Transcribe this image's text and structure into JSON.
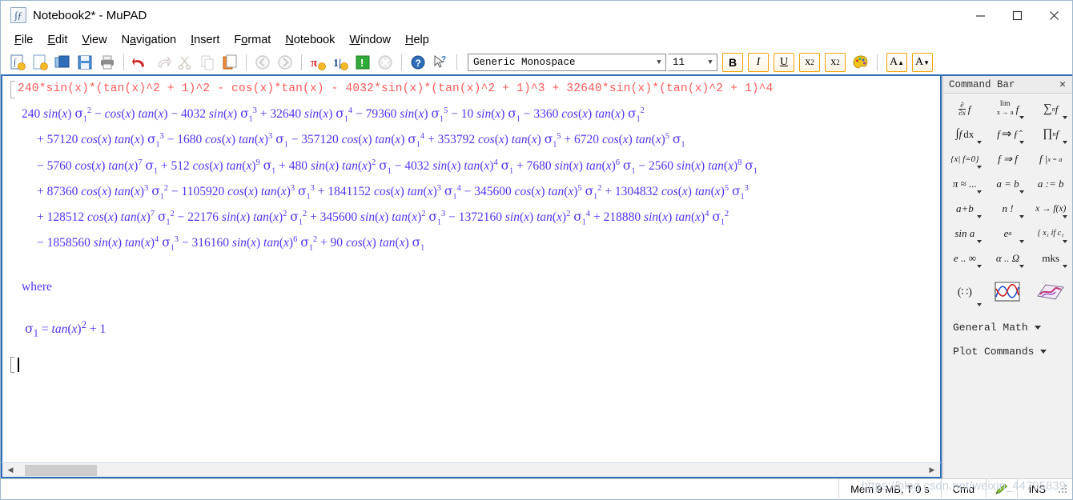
{
  "window": {
    "title": "Notebook2* - MuPAD",
    "app_icon": "mupad-document-icon",
    "minimize": "—",
    "maximize": "☐",
    "close": "✕"
  },
  "menubar": {
    "items": [
      {
        "name": "file",
        "label": "File",
        "accel": "F"
      },
      {
        "name": "edit",
        "label": "Edit",
        "accel": "E"
      },
      {
        "name": "view",
        "label": "View",
        "accel": "V"
      },
      {
        "name": "navigation",
        "label": "Navigation",
        "accel": "a"
      },
      {
        "name": "insert",
        "label": "Insert",
        "accel": "I"
      },
      {
        "name": "format",
        "label": "Format",
        "accel": "o"
      },
      {
        "name": "notebook",
        "label": "Notebook",
        "accel": "N"
      },
      {
        "name": "window",
        "label": "Window",
        "accel": "W"
      },
      {
        "name": "help",
        "label": "Help",
        "accel": "H"
      }
    ]
  },
  "toolbar": {
    "buttons": [
      {
        "name": "new-notebook-icon",
        "tip": "New"
      },
      {
        "name": "new-document-icon",
        "tip": "New Document"
      },
      {
        "name": "open-folder-icon",
        "tip": "Open"
      },
      {
        "name": "save-icon",
        "tip": "Save"
      },
      {
        "name": "print-icon",
        "tip": "Print"
      },
      {
        "name": "undo-icon",
        "tip": "Undo"
      },
      {
        "name": "redo-icon",
        "tip": "Redo"
      },
      {
        "name": "cut-scissors-icon",
        "tip": "Cut"
      },
      {
        "name": "copy-icon",
        "tip": "Copy"
      },
      {
        "name": "paste-icon",
        "tip": "Paste"
      },
      {
        "name": "back-arrow-icon",
        "tip": "Back"
      },
      {
        "name": "forward-arrow-icon",
        "tip": "Forward"
      },
      {
        "name": "pi-evaluate-icon",
        "tip": "Evaluate"
      },
      {
        "name": "evaluate-all-icon",
        "tip": "Evaluate All"
      },
      {
        "name": "exclamation-run-icon",
        "tip": "Run"
      },
      {
        "name": "stop-icon",
        "tip": "Stop"
      },
      {
        "name": "help-question-icon",
        "tip": "Help"
      },
      {
        "name": "help-pointer-icon",
        "tip": "Context Help"
      }
    ],
    "font_family": "Generic Monospace",
    "font_size": "11",
    "bold_label": "B",
    "italic_label": "I",
    "underline_label": "U",
    "subscript_label": "x",
    "subscript_index": "2",
    "superscript_label": "x",
    "superscript_index": "2",
    "color_palette": "color-palette-icon",
    "increase_font_label": "A",
    "decrease_font_label": "A"
  },
  "notebook": {
    "input": "240*sin(x)*(tan(x)^2 + 1)^2 - cos(x)*tan(x) - 4032*sin(x)*(tan(x)^2 + 1)^3 + 32640*sin(x)*(tan(x)^2 + 1)^4",
    "output_lines": [
      "240 sin(x) σ₁² − cos(x) tan(x) − 4032 sin(x) σ₁³ + 32640 sin(x) σ₁⁴ − 79360 sin(x) σ₁⁵ − 10 sin(x) σ₁ − 3360 cos(x) tan(x) σ₁²",
      "+ 57120 cos(x) tan(x) σ₁³ − 1680 cos(x) tan(x)³ σ₁ − 357120 cos(x) tan(x) σ₁⁴ + 353792 cos(x) tan(x) σ₁⁵ + 6720 cos(x) tan(x)⁵ σ₁",
      "− 5760 cos(x) tan(x)⁷ σ₁ + 512 cos(x) tan(x)⁹ σ₁ + 480 sin(x) tan(x)² σ₁ − 4032 sin(x) tan(x)⁴ σ₁ + 7680 sin(x) tan(x)⁶ σ₁ − 2560 sin(x) tan(x)⁸ σ₁",
      "+ 87360 cos(x) tan(x)³ σ₁² − 1105920 cos(x) tan(x)³ σ₁³ + 1841152 cos(x) tan(x)³ σ₁⁴ − 345600 cos(x) tan(x)⁵ σ₁² + 1304832 cos(x) tan(x)⁵ σ₁³",
      "+ 128512 cos(x) tan(x)⁷ σ₁² − 22176 sin(x) tan(x)² σ₁² + 345600 sin(x) tan(x)² σ₁³ − 1372160 sin(x) tan(x)² σ₁⁴ + 218880 sin(x) tan(x)⁴ σ₁²",
      "− 1858560 sin(x) tan(x)⁴ σ₁³ − 316160 sin(x) tan(x)⁶ σ₁² + 90 cos(x) tan(x) σ₁"
    ],
    "where_label": "where",
    "sigma_definition": "σ₁ = tan(x)² + 1",
    "input_color": "#fb5a5a",
    "output_color": "#5533ee",
    "scrollbar": {
      "left_arrow": "◀",
      "right_arrow": "▶"
    }
  },
  "command_bar": {
    "title": "Command Bar",
    "close_label": "✕",
    "buttons": [
      {
        "name": "partial-derivative-button",
        "dropdown": false
      },
      {
        "name": "limit-button",
        "dropdown": true
      },
      {
        "name": "sum-button",
        "dropdown": true
      },
      {
        "name": "integral-button",
        "dropdown": true
      },
      {
        "name": "transform-hat-button",
        "dropdown": true
      },
      {
        "name": "product-button",
        "dropdown": true
      },
      {
        "name": "solve-equation-button",
        "dropdown": true
      },
      {
        "name": "simplify-button",
        "dropdown": false
      },
      {
        "name": "evaluate-at-button",
        "dropdown": false
      },
      {
        "name": "numeric-approx-button",
        "dropdown": true
      },
      {
        "name": "equation-button",
        "dropdown": true
      },
      {
        "name": "assign-button",
        "dropdown": false
      },
      {
        "name": "addition-button",
        "dropdown": true
      },
      {
        "name": "factorial-button",
        "dropdown": true
      },
      {
        "name": "function-map-button",
        "dropdown": true
      },
      {
        "name": "trig-button",
        "dropdown": true
      },
      {
        "name": "exponential-button",
        "dropdown": true
      },
      {
        "name": "piecewise-button",
        "dropdown": true
      },
      {
        "name": "constants-button",
        "dropdown": true
      },
      {
        "name": "greek-letters-button",
        "dropdown": true
      },
      {
        "name": "mks-units-button",
        "dropdown": true
      },
      {
        "name": "matrix-button",
        "dropdown": true
      },
      {
        "name": "plot2d-button",
        "dropdown": false
      },
      {
        "name": "plot3d-button",
        "dropdown": false
      }
    ],
    "labels": {
      "partial": "∂",
      "partial_den": "∂x",
      "f": "f",
      "lim": "lim",
      "lim_sub": "x → a",
      "sum": "∑",
      "sum_sub": "n",
      "integral": "∫",
      "dx": "dx",
      "implies": "⇒",
      "hat_f": "ƒ̂",
      "product": "∏",
      "prod_sub": "n",
      "solve": "{x| f=0}",
      "simplify": "f ⇒ f",
      "eval_at": "f |",
      "eval_sub": "x = a",
      "approx": "π ≈ ...",
      "equation": "a = b",
      "assign": "a := b",
      "addition": "a+b",
      "factorial": "n !",
      "map": "x → f(x)",
      "trig": "sin a",
      "exp": "e",
      "exp_sup": "a",
      "piecewise": "{ x₁ if c₁",
      "constants": "e .. ∞",
      "greek": "α .. Ω",
      "mks": "mks",
      "matrix": "(∷)"
    },
    "dropdowns": [
      {
        "name": "general-math-dropdown",
        "label": "General Math"
      },
      {
        "name": "plot-commands-dropdown",
        "label": "Plot Commands"
      }
    ]
  },
  "statusbar": {
    "memory": "Mem 9 MB, T 0 s",
    "mode": "Cmd",
    "pen_icon": "pencil-icon",
    "insert_mode": "iNS",
    "watermark": "https://blog.csdn.net/weixin_44795839"
  }
}
